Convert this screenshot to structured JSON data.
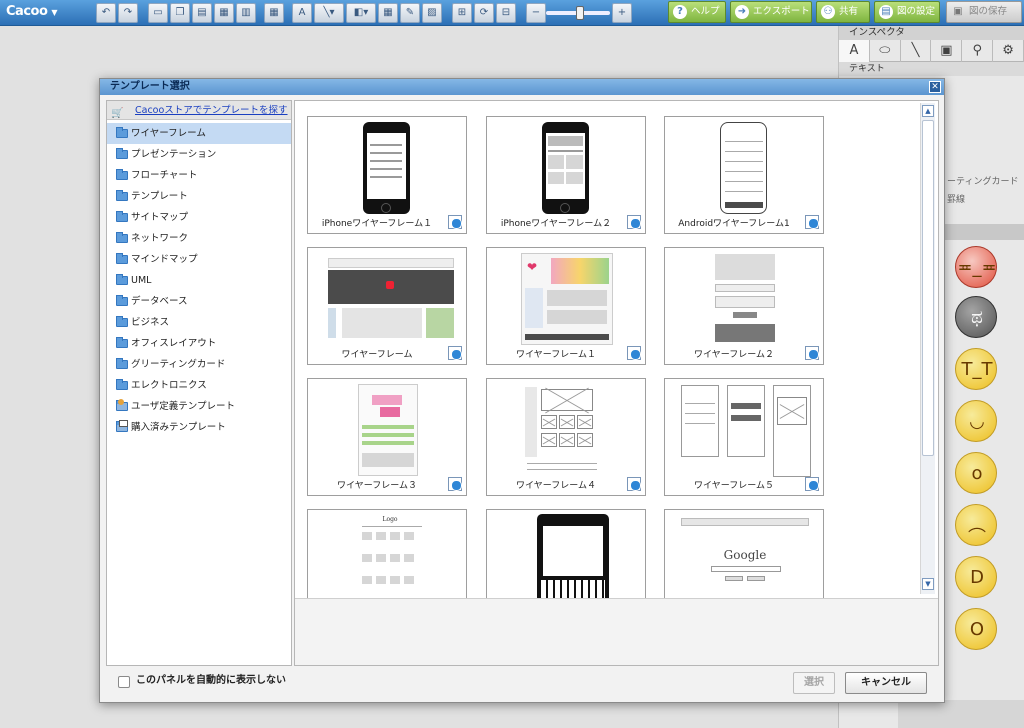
{
  "app": {
    "logo": "Cacoo"
  },
  "toolbar": {
    "undo_icon": "undo-icon",
    "redo_icon": "redo-icon",
    "help_label": "ヘルプ",
    "export_label": "エクスポート",
    "share_label": "共有",
    "settings_label": "図の設定",
    "save_label": "図の保存"
  },
  "inspector": {
    "title": "インスペクタ",
    "tabs": [
      "A",
      "⬭",
      "╲",
      "▣",
      "⚲",
      "⚙"
    ],
    "section_label": "テキスト",
    "ghost_1": "ーティングカード",
    "ghost_2": "罫線"
  },
  "dialog": {
    "title": "テンプレート選択",
    "store_link": "Cacooストアでテンプレートを探す",
    "categories": [
      "ワイヤーフレーム",
      "プレゼンテーション",
      "フローチャート",
      "テンプレート",
      "サイトマップ",
      "ネットワーク",
      "マインドマップ",
      "UML",
      "データベース",
      "ビジネス",
      "オフィスレイアウト",
      "グリーティングカード",
      "エレクトロニクス",
      "ユーザ定義テンプレート",
      "購入済みテンプレート"
    ],
    "selected_category": "ワイヤーフレーム",
    "templates": [
      "iPhoneワイヤーフレーム１",
      "iPhoneワイヤーフレーム２",
      "Androidワイヤーフレーム1",
      "ワイヤーフレーム",
      "ワイヤーフレーム１",
      "ワイヤーフレーム２",
      "ワイヤーフレーム３",
      "ワイヤーフレーム４",
      "ワイヤーフレーム５"
    ],
    "thumb_texts": {
      "google": "Google",
      "logo": "Logo"
    },
    "auto_show_label": "このパネルを自動的に表示しない",
    "select_button": "選択",
    "cancel_button": "キャンセル"
  },
  "colors": {
    "toolbar_blue": "#3d84c9",
    "green_button": "#8bc34a",
    "selected_row": "#c4daf3",
    "link_blue": "#1a3fc0"
  }
}
